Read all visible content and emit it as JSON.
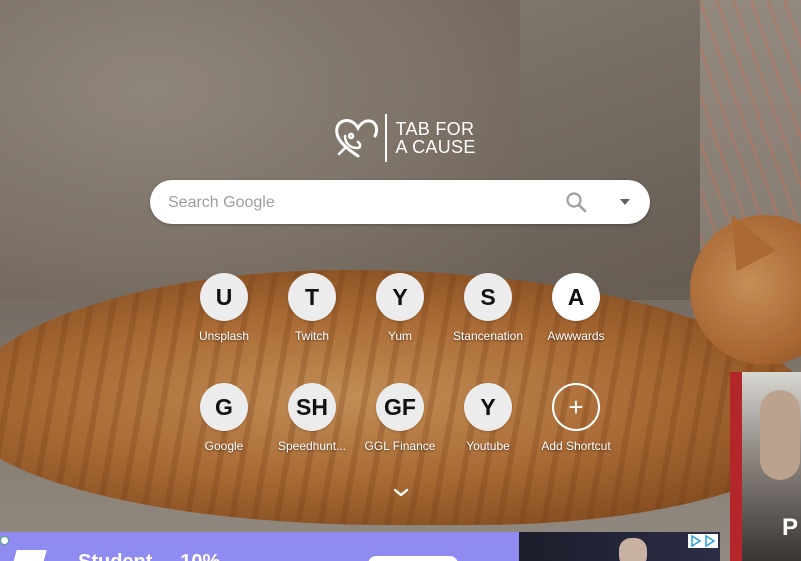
{
  "logo": {
    "line1": "TAB FOR",
    "line2": "A CAUSE",
    "icon": "elephant-heart-logo"
  },
  "search": {
    "placeholder": "Search Google",
    "value": "",
    "icon": "search-icon",
    "dropdown_icon": "caret-down-icon"
  },
  "shortcuts": [
    {
      "letter": "U",
      "label": "Unsplash"
    },
    {
      "letter": "T",
      "label": "Twitch"
    },
    {
      "letter": "Y",
      "label": "Yum"
    },
    {
      "letter": "S",
      "label": "Stancenation"
    },
    {
      "letter": "A",
      "label": "Awwwards"
    },
    {
      "letter": "G",
      "label": "Google"
    },
    {
      "letter": "SH",
      "label": "Speedhunt..."
    },
    {
      "letter": "GF",
      "label": "GGL Finance"
    },
    {
      "letter": "Y",
      "label": "Youtube"
    },
    {
      "letter": "+",
      "label": "Add Shortcut"
    }
  ],
  "scroll_icon": "chevron-down-icon",
  "ads": {
    "bottom_text": "Student ... 10%",
    "right_letter": "P",
    "adchoices_icon": "adchoices-icon"
  },
  "colors": {
    "search_bg": "#ffffff",
    "tile_bg": "#ececec",
    "ad_bg": "#8f8bf0"
  }
}
